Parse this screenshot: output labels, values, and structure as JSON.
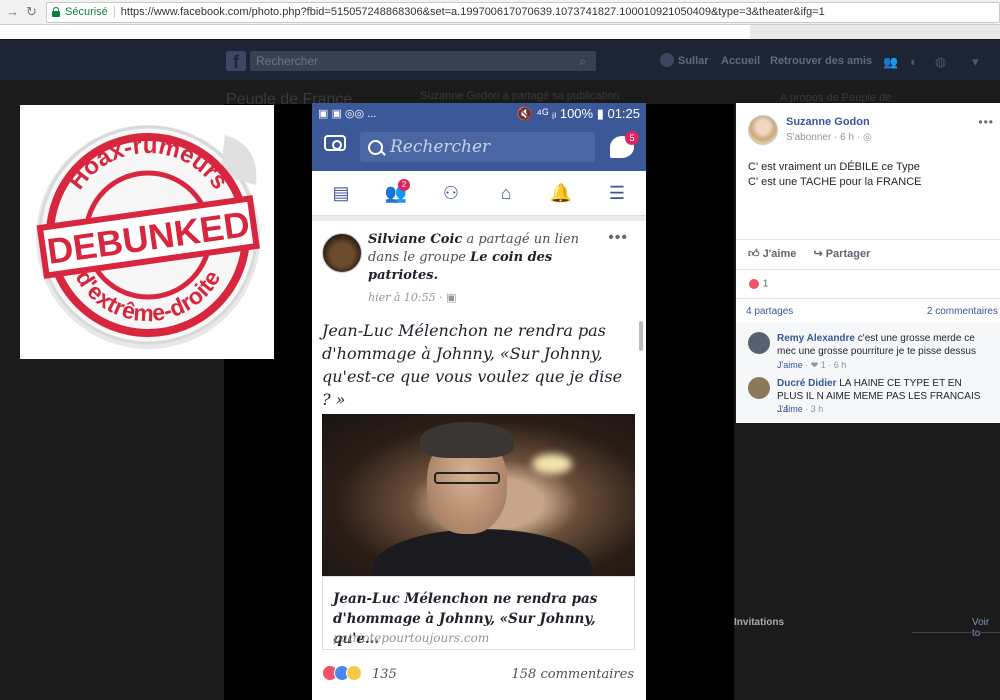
{
  "browser": {
    "secure_label": "Sécurisé",
    "url": "https://www.facebook.com/photo.php?fbid=515057248868306&set=a.199700617070639.1073741827.100010921050409&type=3&theater&ifg=1"
  },
  "fb_header": {
    "search_placeholder": "Rechercher",
    "nav": [
      "Sullar",
      "Accueil",
      "Retrouver des amis"
    ]
  },
  "background": {
    "page_title": "Peuple de France",
    "shared_text": "Suzanne Godon a partagé sa publication",
    "right_text": "A propos de Peuple de"
  },
  "stamp": {
    "top_text": "Hoax-rumeurs",
    "center_text": "DEBUNKED",
    "bottom_text": "d'extrême-droite"
  },
  "phone": {
    "status_left": "▣ ▣ ◎◎ ...",
    "status_right": "🔇 ⁴ᴳ ᵢₗ 100% ▮ 01:25",
    "search_placeholder": "Rechercher",
    "messenger_badge": "5",
    "friends_badge": "2",
    "post": {
      "author": "Silviane Coic",
      "shared_text": "a partagé un lien dans le groupe",
      "group": "Le coin des patriotes.",
      "time": "hier à 10:55 · ▣",
      "text": "Jean-Luc Mélenchon ne rendra pas d'hommage à Johnny, «Sur Johnny, qu'est-ce que vous voulez que je dise ? »",
      "link_title": "Jean-Luc Mélenchon ne rendra pas d'hommage à Johnny, «Sur Johnny, qu'e...",
      "link_domain": "patriotepourtoujours.com",
      "reactions_count": "135",
      "comments_count": "158 commentaires"
    }
  },
  "right_panel": {
    "author": "Suzanne Godon",
    "subscribe": "S'abonner · 6 h · ◎",
    "text_line1": "C' est vraiment un DÉBILE ce Type",
    "text_line2": "C' est une TACHE pour la FRANCE",
    "like_label": "J'aime",
    "share_label": "Partager",
    "reactions": "1",
    "shares": "4 partages",
    "comments_link": "2 commentaires",
    "comments": [
      {
        "name": "Remy Alexandre",
        "text": "c'est une grosse merde ce mec une grosse pourriture je te pisse dessus",
        "like": "J'aime",
        "meta": "· ❤ 1 · 6 h"
      },
      {
        "name": "Ducré Didier",
        "text": "LA HAINE CE TYPE ET EN PLUS IL N AIME MEME PAS LES FRANCAIS ...!",
        "like": "J'aime",
        "meta": "· 3 h"
      }
    ]
  },
  "sidebar": {
    "invitations": "Invitations",
    "see_all": "Voir to"
  },
  "colors": {
    "facebook_blue": "#3b5998",
    "stamp_red": "#d7263d",
    "badge_red": "#e0245e"
  }
}
